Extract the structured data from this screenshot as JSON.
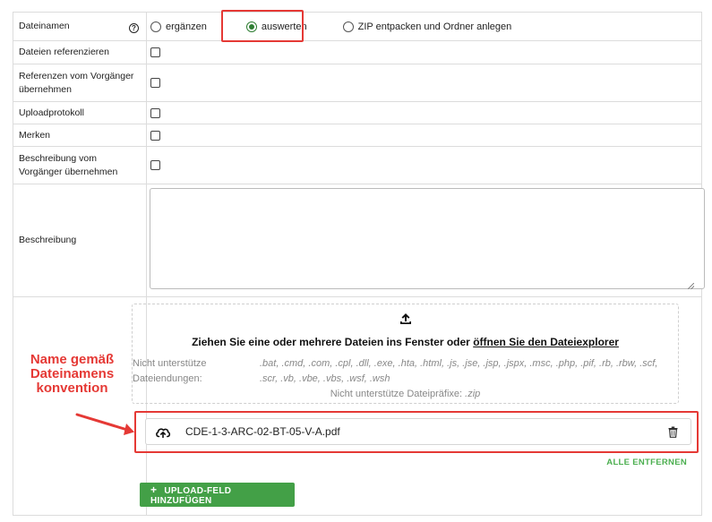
{
  "form": {
    "rows": [
      {
        "label": "Dateinamen"
      },
      {
        "label": "Dateien referenzieren"
      },
      {
        "label": "Referenzen vom Vorgänger übernehmen"
      },
      {
        "label": "Uploadprotokoll"
      },
      {
        "label": "Merken"
      },
      {
        "label": "Beschreibung vom Vorgänger übernehmen"
      },
      {
        "label": "Beschreibung"
      }
    ],
    "help_glyph": "?",
    "radio_options": [
      {
        "label": "ergänzen",
        "checked": false
      },
      {
        "label": "auswerten",
        "checked": true
      },
      {
        "label": "ZIP entpacken und Ordner anlegen",
        "checked": false
      }
    ],
    "description_value": ""
  },
  "upload": {
    "drop_text": "Ziehen Sie eine oder mehrere Dateien ins Fenster oder",
    "drop_link": "öffnen Sie den Dateiexplorer",
    "unsupported_label": "Nicht unterstütze Dateiendungen:",
    "unsupported_extensions": ".bat, .cmd, .com, .cpl, .dll, .exe, .hta, .html, .js, .jse, .jsp, .jspx, .msc, .php, .pif, .rb, .rbw, .scf, .scr, .vb, .vbe, .vbs, .wsf, .wsh",
    "unsupported_prefix_label": "Nicht unterstütze Dateipräfixe:",
    "unsupported_prefix": ".zip",
    "file_name": "CDE-1-3-ARC-02-BT-05-V-A.pdf",
    "remove_all": "ALLE ENTFERNEN",
    "add_field": "UPLOAD-FELD HINZUFÜGEN",
    "add_glyph": "+",
    "icons": {
      "upload": "upload-icon",
      "cloud": "cloud-upload-icon",
      "trash": "trash-icon"
    }
  },
  "annotation": {
    "line1": "Name gemäß",
    "line2": "Dateinamens",
    "line3": "konvention",
    "color": "#e53935"
  },
  "colors": {
    "accent": "#43a047",
    "highlight": "#e53935",
    "radio_checked": "#2e7d32"
  }
}
